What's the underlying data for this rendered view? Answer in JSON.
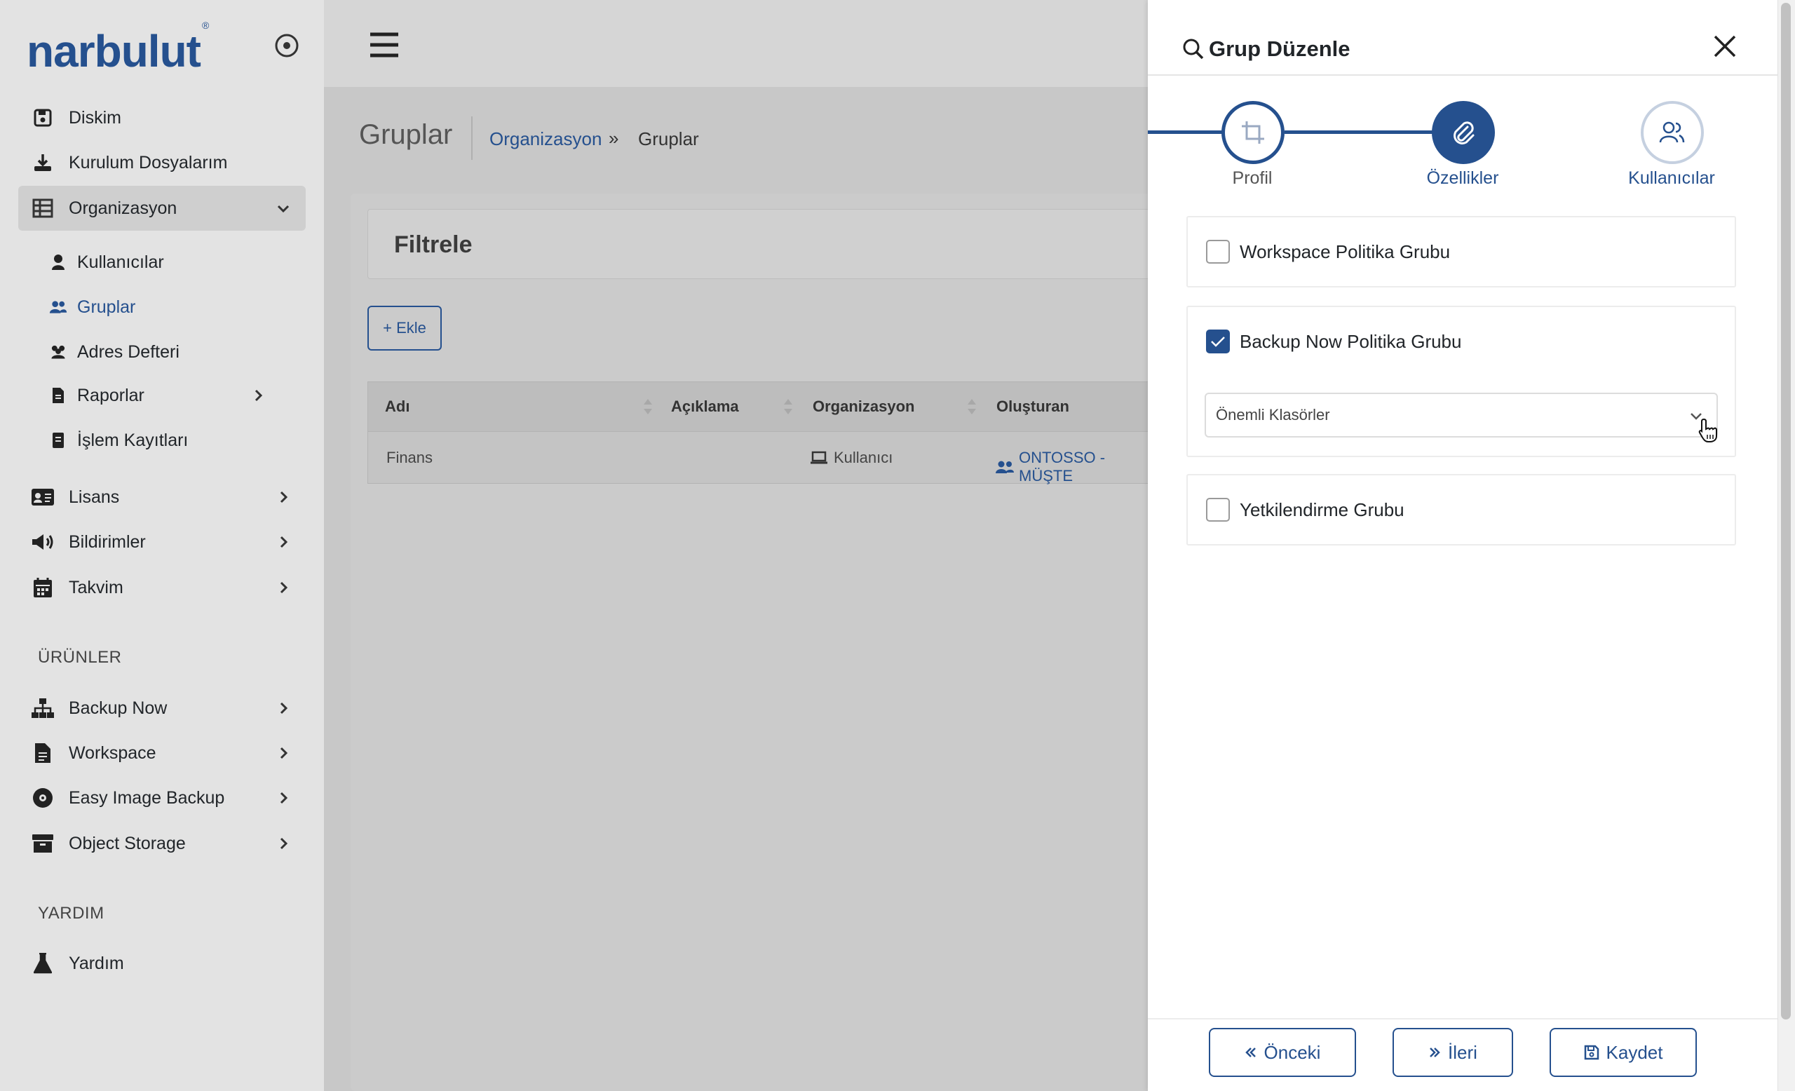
{
  "brand": {
    "name": "narbulut",
    "mark": "®"
  },
  "sidebar": {
    "items": [
      {
        "label": "Diskim",
        "icon": "disk-icon"
      },
      {
        "label": "Kurulum Dosyalarım",
        "icon": "download-icon"
      },
      {
        "label": "Organizasyon",
        "icon": "table-icon",
        "expanded": true
      },
      {
        "label": "Lisans",
        "icon": "id-card-icon"
      },
      {
        "label": "Bildirimler",
        "icon": "megaphone-icon"
      },
      {
        "label": "Takvim",
        "icon": "calendar-icon"
      }
    ],
    "org_sub": [
      {
        "label": "Kullanıcılar",
        "icon": "user-icon"
      },
      {
        "label": "Gruplar",
        "icon": "users-icon",
        "active": true
      },
      {
        "label": "Adres Defteri",
        "icon": "address-book-icon"
      },
      {
        "label": "Raporlar",
        "icon": "report-icon"
      },
      {
        "label": "İşlem Kayıtları",
        "icon": "log-icon"
      }
    ],
    "products_label": "ÜRÜNLER",
    "products": [
      {
        "label": "Backup Now",
        "icon": "sitemap-icon"
      },
      {
        "label": "Workspace",
        "icon": "file-icon"
      },
      {
        "label": "Easy Image Backup",
        "icon": "disc-icon"
      },
      {
        "label": "Object Storage",
        "icon": "archive-icon"
      }
    ],
    "help_label": "YARDIM",
    "help": [
      {
        "label": "Yardım",
        "icon": "flask-icon"
      }
    ]
  },
  "page": {
    "title": "Gruplar",
    "breadcrumb": [
      "Organizasyon",
      "»",
      "Gruplar"
    ],
    "filter_title": "Filtrele",
    "add_label": "+ Ekle"
  },
  "table": {
    "columns": [
      "Adı",
      "Açıklama",
      "Organizasyon",
      "Oluşturan"
    ],
    "rows": [
      {
        "name": "Finans",
        "description": "",
        "organization": "Kullanıcı",
        "creator": "ONTOSSO - MÜŞTE"
      }
    ]
  },
  "drawer": {
    "title": "Grup Düzenle",
    "steps": [
      {
        "label": "Profil",
        "icon": "crop-icon",
        "state": "done"
      },
      {
        "label": "Özellikler",
        "icon": "paperclip-icon",
        "state": "active"
      },
      {
        "label": "Kullanıcılar",
        "icon": "users-icon",
        "state": "pending"
      }
    ],
    "options": [
      {
        "label": "Workspace Politika Grubu",
        "checked": false
      },
      {
        "label": "Backup Now Politika Grubu",
        "checked": true,
        "select_value": "Önemli Klasörler"
      },
      {
        "label": "Yetkilendirme Grubu",
        "checked": false
      }
    ],
    "buttons": {
      "prev": "Önceki",
      "next": "İleri",
      "save": "Kaydet"
    }
  },
  "colors": {
    "primary": "#25508e",
    "overlay": "#c8c8c8",
    "sidebar": "#e3e3e3"
  }
}
